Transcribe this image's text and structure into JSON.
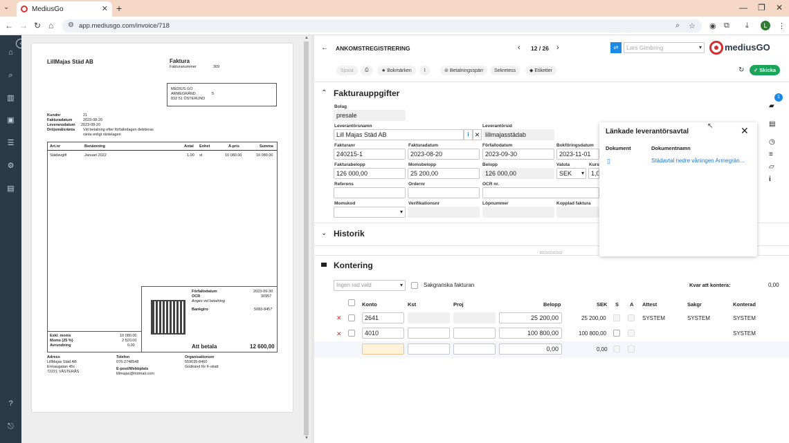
{
  "browser": {
    "tab_title": "MediusGo",
    "url": "app.mediusgo.com/invoice/718"
  },
  "invoice_doc": {
    "seller": "LillMajas Städ AB",
    "doc_title": "Faktura",
    "fakturanummer_label": "Fakturanummer",
    "fakturanummer": "309",
    "recipient": [
      "MEDIUS GO",
      "ARMEGRÄND",
      "832 51 ÖSTERUND"
    ],
    "recipient_num": "5",
    "meta": [
      {
        "label": "Kundnr",
        "value": "21"
      },
      {
        "label": "Fakturadatum",
        "value": "2023-08-20"
      },
      {
        "label": "Leveransdatum",
        "value": "2023-08-20"
      },
      {
        "label": "Dröjsmålsränta",
        "value": "Vid betalning efter förfallodagen debiteras"
      },
      {
        "label": "",
        "value": "ränta enligt räntelagen"
      }
    ],
    "table_headers": [
      "Art.nr",
      "Benämning",
      "Antal",
      "Enhet",
      "Á-pris",
      "Summa"
    ],
    "rows": [
      {
        "art": "Städavgift",
        "ben": "Januari 2022",
        "antal": "1.00",
        "enhet": "st",
        "apris": "10 080.00",
        "summa": "10 080.00"
      }
    ],
    "due_label": "Förfallodatum",
    "due": "2023-09-30",
    "ocr_label": "OCR",
    "ocr": "30957",
    "ocr_note": "Anges vid betalning",
    "bankgiro_label": "Bankgiro",
    "bankgiro": "5083-8457",
    "totals": [
      {
        "label": "Exkl. moms",
        "value": "10 080.00"
      },
      {
        "label": "Moms (25 %)",
        "value": "2 520.00"
      },
      {
        "label": "Avrundning",
        "value": "0.00"
      }
    ],
    "att_betala_label": "Att betala",
    "att_betala": "12 600,00",
    "footer": {
      "adress_label": "Adress",
      "adress": [
        "LillMajas Städ AB",
        "Ermaugatan 45c",
        "72221 VÄSTERÅS"
      ],
      "telefon_label": "Telefon",
      "telefon": "076-2748548",
      "epost_label": "E-post/Webbplats",
      "epost": "lillmajas@hotmail.com",
      "org_label": "Organisationsnr",
      "org": "559035-8460",
      "fskatt": "Godkänd för F-skatt"
    }
  },
  "header": {
    "back_icon": "arrow-left-icon",
    "title": "ANKOMSTREGISTRERING",
    "pager": "12 / 26",
    "user_select": "Lars Gimbring",
    "logo_text": "mediusGO"
  },
  "toolbar": {
    "spara": "Spara",
    "bokmarken": "Bokmärken",
    "betalningsparr": "Betalningsspärr",
    "sekretess": "Sekretess",
    "etiketter": "Etiketter",
    "skicka": "Skicka"
  },
  "fakturauppgifter": {
    "title": "Fakturauppgifter",
    "bolag_label": "Bolag",
    "bolag": "presale",
    "leverantorsnamn_label": "Leverantörsnamn",
    "leverantorsnamn": "Lill Majas Städ AB",
    "leverantorsid_label": "Leverantörsid",
    "leverantorsid": "lillmajasstädab",
    "fakturanr_label": "Fakturanr",
    "fakturanr": "240215-1",
    "fakturadatum_label": "Fakturadatum",
    "fakturadatum": "2023-08-20",
    "forfallodatum_label": "Förfallodatum",
    "forfallodatum": "2023-09-30",
    "bokforingsdatum_label": "Bokföringsdatum",
    "bokforingsdatum": "2023-11-01",
    "fakturabelopp_label": "Fakturabelopp",
    "fakturabelopp": "126 000,00",
    "momsbelopp_label": "Momsbelopp",
    "momsbelopp": "25 200,00",
    "belopp_label": "Belopp",
    "belopp": "126 000,00",
    "valuta_label": "Valuta",
    "valuta": "SEK",
    "kurs_label": "Kurs",
    "kurs": "1,0",
    "referens_label": "Referens",
    "ordernr_label": "Ordernr",
    "ocrnr_label": "OCR nr.",
    "momskod_label": "Momskod",
    "verifikationsnr_label": "Verifikationsnr",
    "lopnummer_label": "Löpnummer",
    "kopplad_label": "Kopplad faktura"
  },
  "historik": {
    "title": "Historik"
  },
  "kontering": {
    "title": "Kontering",
    "rad_placeholder": "Ingen rad vald",
    "sakgranska": "Sakgranska fakturan",
    "kvar_label": "Kvar att kontera:",
    "kvar_value": "0,00",
    "headers": [
      "Konto",
      "Kst",
      "Proj",
      "Belopp",
      "SEK",
      "S",
      "A",
      "Attest",
      "Sakgr",
      "Konterad"
    ],
    "rows": [
      {
        "konto": "2641",
        "belopp": "25 200,00",
        "sek": "25 200,00",
        "attest": "SYSTEM",
        "sakgr": "SYSTEM",
        "konterad": "SYSTEM"
      },
      {
        "konto": "4010",
        "belopp": "100 800,00",
        "sek": "100 800,00",
        "attest": "",
        "sakgr": "",
        "konterad": "SYSTEM"
      }
    ],
    "new_row": {
      "belopp": "0,00",
      "sek": "0,00"
    }
  },
  "popup": {
    "title": "Länkade leverantörsavtal",
    "col_dokument": "Dokument",
    "col_dokumentnamn": "Dokumentnamn",
    "row_name": "Städavtal nedre våningen Armegrän..."
  },
  "side": {
    "badge": "1"
  },
  "colors": {
    "accent": "#1aa55a",
    "rail": "#2b3a48",
    "brand_red": "#d32f2f",
    "link": "#1976d2"
  }
}
